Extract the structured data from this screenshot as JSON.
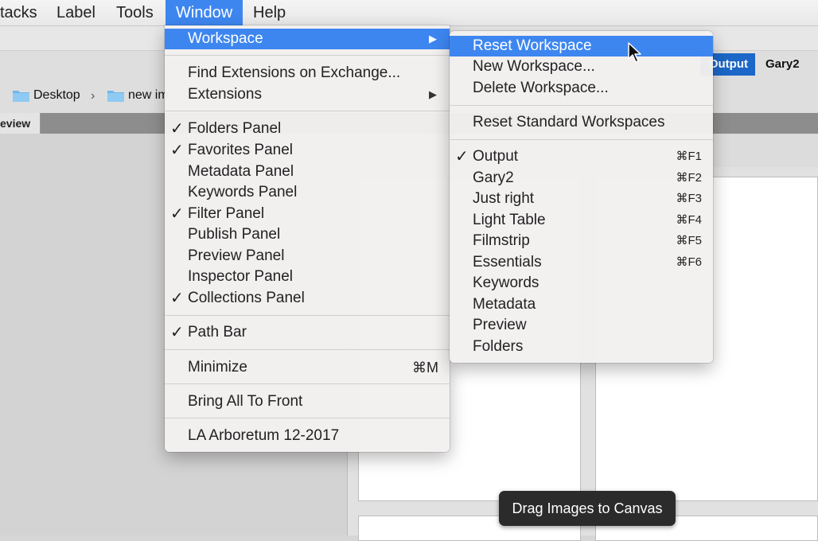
{
  "menubar": {
    "items": [
      {
        "label": "tacks"
      },
      {
        "label": "Label"
      },
      {
        "label": "Tools"
      },
      {
        "label": "Window"
      },
      {
        "label": "Help"
      }
    ]
  },
  "pathbar": {
    "crumbs": [
      "Desktop",
      "new im"
    ]
  },
  "tabs": {
    "preview": "eview"
  },
  "workspace_bar": {
    "output": "Output",
    "gary2": "Gary2"
  },
  "window_menu": {
    "workspace": "Workspace",
    "find_extensions": "Find Extensions on Exchange...",
    "extensions": "Extensions",
    "panels": [
      {
        "label": "Folders Panel",
        "checked": true
      },
      {
        "label": "Favorites Panel",
        "checked": true
      },
      {
        "label": "Metadata Panel",
        "checked": false
      },
      {
        "label": "Keywords Panel",
        "checked": false
      },
      {
        "label": "Filter Panel",
        "checked": true
      },
      {
        "label": "Publish Panel",
        "checked": false
      },
      {
        "label": "Preview Panel",
        "checked": false
      },
      {
        "label": "Inspector Panel",
        "checked": false
      },
      {
        "label": "Collections Panel",
        "checked": true
      }
    ],
    "path_bar": "Path Bar",
    "minimize": "Minimize",
    "minimize_shortcut": "⌘M",
    "bring_all_to_front": "Bring All To Front",
    "la_arboretum": "LA Arboretum 12-2017"
  },
  "workspace_submenu": {
    "reset_workspace": "Reset Workspace",
    "new_workspace": "New Workspace...",
    "delete_workspace": "Delete Workspace...",
    "reset_standard": "Reset Standard Workspaces",
    "workspaces": [
      {
        "label": "Output",
        "shortcut": "⌘F1",
        "checked": true
      },
      {
        "label": "Gary2",
        "shortcut": "⌘F2",
        "checked": false
      },
      {
        "label": "Just right",
        "shortcut": "⌘F3",
        "checked": false
      },
      {
        "label": "Light Table",
        "shortcut": "⌘F4",
        "checked": false
      },
      {
        "label": "Filmstrip",
        "shortcut": "⌘F5",
        "checked": false
      },
      {
        "label": "Essentials",
        "shortcut": "⌘F6",
        "checked": false
      },
      {
        "label": "Keywords",
        "shortcut": "",
        "checked": false
      },
      {
        "label": "Metadata",
        "shortcut": "",
        "checked": false
      },
      {
        "label": "Preview",
        "shortcut": "",
        "checked": false
      },
      {
        "label": "Folders",
        "shortcut": "",
        "checked": false
      }
    ]
  },
  "canvas": {
    "hint": "Drag Images to Canvas"
  },
  "colors": {
    "highlight": "#3d86f0",
    "output_button": "#1c67c7"
  }
}
